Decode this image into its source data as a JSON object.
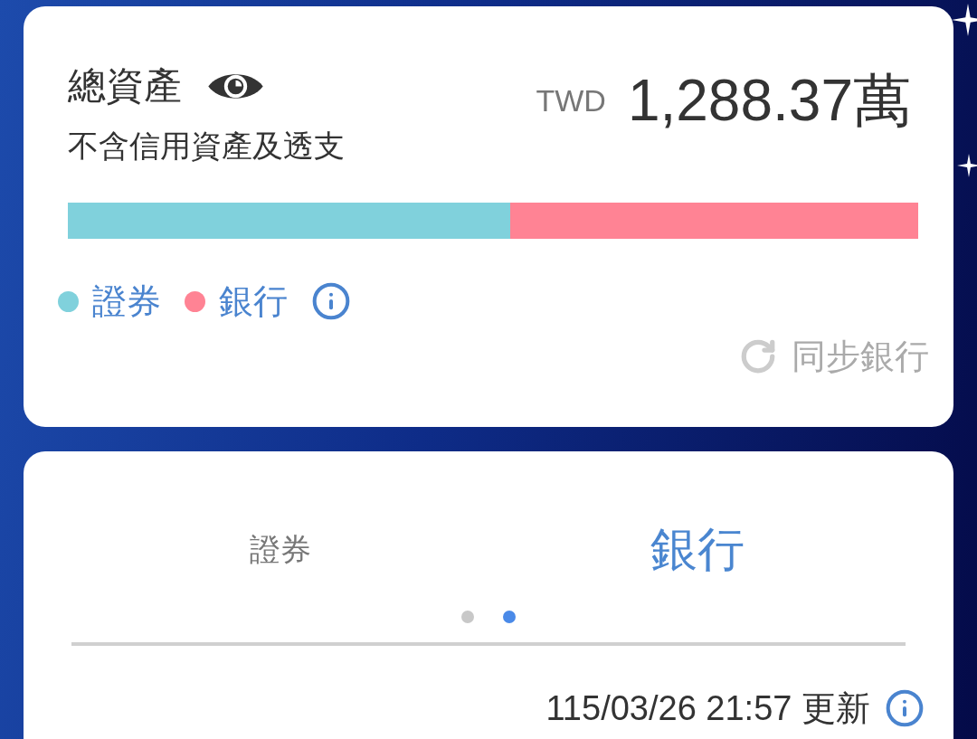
{
  "total_assets_card": {
    "title": "總資產",
    "currency": "TWD",
    "amount": "1,288.37萬",
    "note": "不含信用資產及透支",
    "allocation_bar": {
      "level": 0.52
    },
    "legend": [
      {
        "label": "證券",
        "color": "#80d1dc"
      },
      {
        "label": "銀行",
        "color": "#ff8394"
      }
    ],
    "sync_label": "同步銀行"
  },
  "accounts_card": {
    "tabs": [
      {
        "label": "證券",
        "selected": false
      },
      {
        "label": "銀行",
        "selected": true
      }
    ],
    "page_dots": [
      {
        "selected": false
      },
      {
        "selected": true
      }
    ],
    "updated": "115/03/26 21:57 更新"
  }
}
